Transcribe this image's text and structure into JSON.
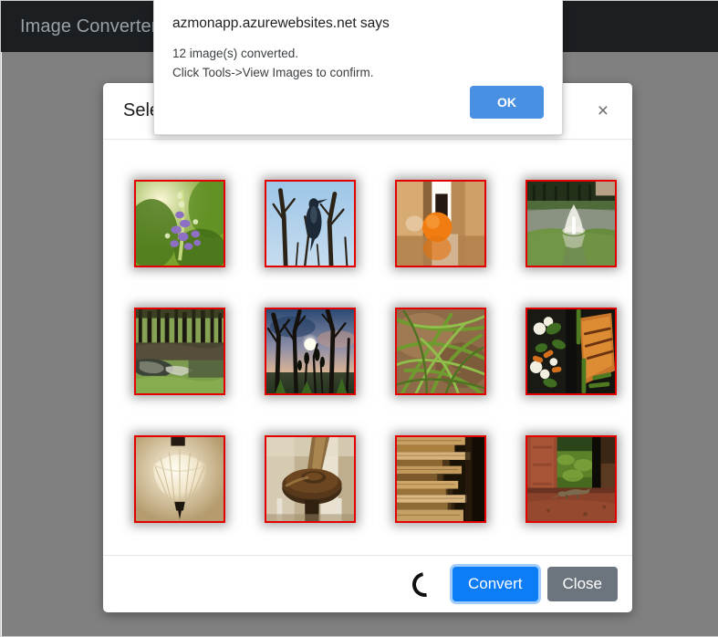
{
  "navbar": {
    "brand": "Image Converter"
  },
  "modal": {
    "title": "Select Images",
    "close_icon_label": "×",
    "footer": {
      "convert_label": "Convert",
      "close_label": "Close",
      "spinner_name": "loading-spinner"
    },
    "thumbnails": [
      {
        "name": "purple-flower-spike",
        "alt": "Purple flower spike against blurred green foliage"
      },
      {
        "name": "bird-on-bare-branches",
        "alt": "Cormorant perched on bare tree branches under blue sky"
      },
      {
        "name": "orange-on-table",
        "alt": "Orange fruit on a reflective surface in a warm interior"
      },
      {
        "name": "pond-fountain",
        "alt": "Water fountain in a pond bordered by green grass"
      },
      {
        "name": "forest-stream",
        "alt": "Stream running through a grassy forest of bare trees"
      },
      {
        "name": "sunset-through-trees",
        "alt": "Sun setting behind bare trees with silhouetted reeds"
      },
      {
        "name": "grass-closeup",
        "alt": "Close-up of green grass blades over brown leaves"
      },
      {
        "name": "food-plate",
        "alt": "Plated grilled fish with vegetables on a dark tray"
      },
      {
        "name": "pendant-ceiling-lamp",
        "alt": "Frosted glass pendant ceiling lamp"
      },
      {
        "name": "wooden-banister",
        "alt": "Close-up of a polished wooden newel post and banister"
      },
      {
        "name": "stacked-books",
        "alt": "Stack of books viewed edge-on"
      },
      {
        "name": "lizard-by-column",
        "alt": "Lizard on red stone beside a brick column with grass behind"
      }
    ]
  },
  "alert": {
    "origin": "azmonapp.azurewebsites.net says",
    "message_line1": "12 image(s) converted.",
    "message_line2": "Click Tools->View Images to confirm.",
    "ok_label": "OK"
  },
  "colors": {
    "navbar_bg": "#1b1f22",
    "backdrop": "#808080",
    "selected_border": "#e50000",
    "convert_btn": "#0d7cf7",
    "close_btn": "#6c757d",
    "ok_btn": "#4a90e2"
  }
}
